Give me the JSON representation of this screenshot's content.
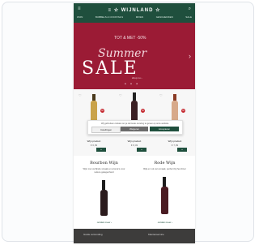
{
  "colors": {
    "brand_green": "#1f4f3d",
    "hero_red": "#9b1b35",
    "badge_red": "#c5282f"
  },
  "topbar": {
    "brand": "≡ ☆ WIJNLAND ☆",
    "menu_icon": "menu-icon",
    "search_icon": "search-icon",
    "nav": [
      "WIJN",
      "BUBBELS & COCKTAILS",
      "MIXEN",
      "GESCHENKEN",
      "SALE"
    ]
  },
  "hero": {
    "top_text": "TOT & MET -50%",
    "script": "Summer",
    "sale": "SALE",
    "link": "shop nu ›",
    "dots": "• • •"
  },
  "products": [
    {
      "name": "Wijn product",
      "price": "€ 6,99",
      "badge": "%",
      "btn": "+"
    },
    {
      "name": "Wijn product",
      "price": "€ 8,49",
      "badge": "%",
      "btn": "+"
    },
    {
      "name": "Wijn product",
      "price": "€ 7,99",
      "badge": "%",
      "btn": "+"
    }
  ],
  "cookie": {
    "text": "Wij gebruiken cookies om je de beste ervaring te geven op onze website.",
    "settings": "Instellingen",
    "decline": "Weigeren",
    "accept": "Accepteren"
  },
  "categories": [
    {
      "title": "Bourbon Wijn",
      "desc": "Wijn met verfijnde smaak en aroma's voor iedere gelegenheid",
      "link": "ontdek meer ›"
    },
    {
      "title": "Rode Wijn",
      "desc": "Rijk en vol van smaak, perfect bij het diner",
      "link": "ontdek meer ›"
    }
  ],
  "footer": {
    "left": "Gratis verzending",
    "right": "Klantenservice"
  }
}
